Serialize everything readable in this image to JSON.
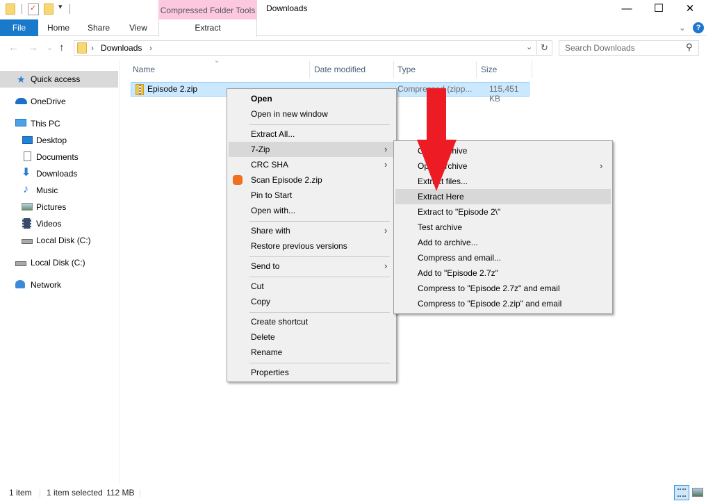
{
  "window": {
    "title": "Downloads",
    "context_tab_group": "Compressed Folder Tools",
    "controls": {
      "minimize": "—",
      "maximize": "☐",
      "close": "✕"
    }
  },
  "quick_access_toolbar": {
    "icons": [
      "folder-icon",
      "properties-icon",
      "new-folder-icon",
      "customize-dropdown-icon"
    ]
  },
  "ribbon": {
    "tabs": [
      {
        "label": "File",
        "active": true
      },
      {
        "label": "Home"
      },
      {
        "label": "Share"
      },
      {
        "label": "View"
      },
      {
        "label": "Extract"
      }
    ],
    "collapse_glyph": "⌄",
    "help_glyph": "?"
  },
  "navigation": {
    "back_glyph": "←",
    "forward_glyph": "→",
    "recent_glyph": "⌄",
    "up_glyph": "↑",
    "breadcrumb": [
      "Downloads"
    ],
    "breadcrumb_sep": "›",
    "address_dropdown_glyph": "⌄",
    "refresh_glyph": "↻",
    "search_placeholder": "Search Downloads",
    "search_glyph": "⚲"
  },
  "sidebar": {
    "items": [
      {
        "label": "Quick access",
        "icon": "star-icon",
        "selected": true
      },
      {
        "label": "OneDrive",
        "icon": "cloud-icon"
      },
      {
        "label": "This PC",
        "icon": "computer-icon"
      },
      {
        "label": "Desktop",
        "icon": "desktop-icon"
      },
      {
        "label": "Documents",
        "icon": "documents-icon"
      },
      {
        "label": "Downloads",
        "icon": "download-icon"
      },
      {
        "label": "Music",
        "icon": "music-icon"
      },
      {
        "label": "Pictures",
        "icon": "pictures-icon"
      },
      {
        "label": "Videos",
        "icon": "videos-icon"
      },
      {
        "label": "Local Disk (C:)",
        "icon": "drive-icon"
      },
      {
        "label": "Local Disk (C:)",
        "icon": "drive-icon"
      },
      {
        "label": "Network",
        "icon": "network-icon"
      }
    ]
  },
  "file_list": {
    "columns": [
      "Name",
      "Date modified",
      "Type",
      "Size"
    ],
    "sort_glyph": "⌄",
    "rows": [
      {
        "name": "Episode 2.zip",
        "date": "",
        "type": "Compressed (zipp...",
        "size": "115,451 KB",
        "selected": true
      }
    ]
  },
  "context_menu": {
    "items": [
      {
        "label": "Open",
        "bold": true
      },
      {
        "label": "Open in new window"
      },
      {
        "separator": true
      },
      {
        "label": "Extract All..."
      },
      {
        "label": "7-Zip",
        "submenu": true,
        "highlighted": true
      },
      {
        "label": "CRC SHA",
        "submenu": true
      },
      {
        "label": "Scan Episode 2.zip",
        "icon": "avast-icon"
      },
      {
        "label": "Pin to Start"
      },
      {
        "label": "Open with..."
      },
      {
        "separator": true
      },
      {
        "label": "Share with",
        "submenu": true
      },
      {
        "label": "Restore previous versions"
      },
      {
        "separator": true
      },
      {
        "label": "Send to",
        "submenu": true
      },
      {
        "separator": true
      },
      {
        "label": "Cut"
      },
      {
        "label": "Copy"
      },
      {
        "separator": true
      },
      {
        "label": "Create shortcut"
      },
      {
        "label": "Delete"
      },
      {
        "label": "Rename"
      },
      {
        "separator": true
      },
      {
        "label": "Properties"
      }
    ],
    "submenu_glyph": "›"
  },
  "sevenzip_submenu": {
    "items": [
      {
        "label": "Open archive"
      },
      {
        "label": "Open archive",
        "submenu": true
      },
      {
        "label": "Extract files..."
      },
      {
        "label": "Extract Here",
        "highlighted": true
      },
      {
        "label": "Extract to \"Episode 2\\\""
      },
      {
        "label": "Test archive"
      },
      {
        "label": "Add to archive..."
      },
      {
        "label": "Compress and email..."
      },
      {
        "label": "Add to \"Episode 2.7z\""
      },
      {
        "label": "Compress to \"Episode 2.7z\" and email"
      },
      {
        "label": "Compress to \"Episode 2.zip\" and email"
      }
    ]
  },
  "annotation": {
    "type": "arrow-down",
    "color": "#ed1c24",
    "points_to": "Extract Here"
  },
  "status_bar": {
    "item_count": "1 item",
    "selection": "1 item selected",
    "selection_size": "112 MB"
  },
  "colors": {
    "file_tab": "#1979ca",
    "context_tab": "#fcc8e0",
    "selection": "#cce8ff",
    "menu_bg": "#f0f0f0",
    "arrow": "#ed1c24"
  }
}
